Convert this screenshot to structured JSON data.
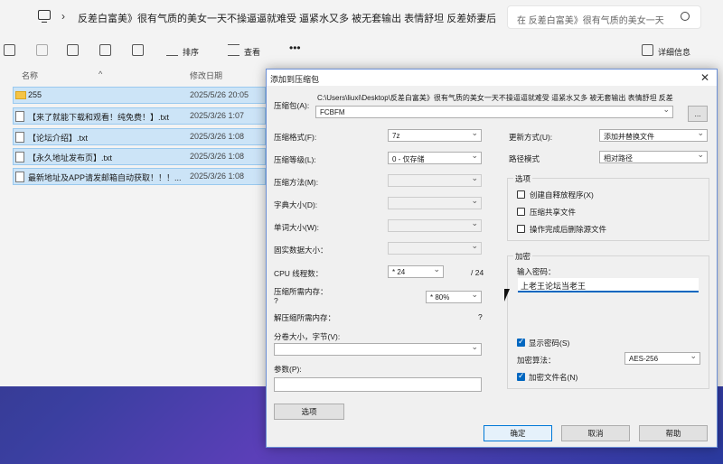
{
  "explorer": {
    "path": "反差白富美》很有气质的美女一天不操逼逼就难受 逼紧水又多 被无套输出 表情舒坦 反差娇妻后",
    "search_placeholder": "在 反差白富美》很有气质的美女一天",
    "toolbar": {
      "sort_label": "排序",
      "view_label": "查看",
      "details_label": "详细信息"
    },
    "columns": {
      "name": "名称",
      "date": "修改日期"
    },
    "files": [
      {
        "name": "255",
        "date": "2025/5/26 20:05",
        "type": "folder"
      },
      {
        "name": "【来了就能下载和观看！纯免费！】.txt",
        "date": "2025/3/26 1:07",
        "type": "txt"
      },
      {
        "name": "【论坛介绍】.txt",
        "date": "2025/3/26 1:08",
        "type": "txt"
      },
      {
        "name": "【永久地址发布页】.txt",
        "date": "2025/3/26 1:08",
        "type": "txt"
      },
      {
        "name": "最新地址及APP请发邮箱自动获取！！！...",
        "date": "2025/3/26 1:08",
        "type": "txt"
      }
    ]
  },
  "dialog": {
    "title": "添加到压缩包",
    "archive_label": "压缩包(A):",
    "archive_path": "C:\\Users\\liuxi\\Desktop\\反差白富美》很有气质的美女一天不操逼逼就难受 逼紧水又多 被无套输出 表情舒坦 反差",
    "archive_name": "FCBFM",
    "browse_label": "...",
    "format_label": "压缩格式(F):",
    "format_value": "7z",
    "level_label": "压缩等级(L):",
    "level_value": "0 - 仅存储",
    "method_label": "压缩方法(M):",
    "dict_label": "字典大小(D):",
    "word_label": "单词大小(W):",
    "solid_label": "固实数据大小：",
    "threads_label": "CPU 线程数：",
    "threads_value": "* 24",
    "threads_max": "/ 24",
    "mem_comp_label": "压缩所需内存：",
    "mem_comp_q": "?",
    "mem_comp_value": "* 80%",
    "mem_decomp_label": "解压缩所需内存：",
    "mem_decomp_value": "?",
    "split_label": "分卷大小，字节(V):",
    "params_label": "参数(P):",
    "options_button": "选项",
    "update_label": "更新方式(U):",
    "update_value": "添加并替换文件",
    "pathmode_label": "路径模式",
    "pathmode_value": "相对路径",
    "options_group": "选项",
    "opt_sfx": "创建自释放程序(X)",
    "opt_shared": "压缩共享文件",
    "opt_delete": "操作完成后删除源文件",
    "encrypt_group": "加密",
    "pwd_label": "输入密码：",
    "pwd_value": "上老王论坛当老王",
    "show_pwd": "显示密码(S)",
    "enc_method_label": "加密算法：",
    "enc_method_value": "AES-256",
    "enc_names": "加密文件名(N)",
    "ok": "确定",
    "cancel": "取消",
    "help": "帮助"
  }
}
